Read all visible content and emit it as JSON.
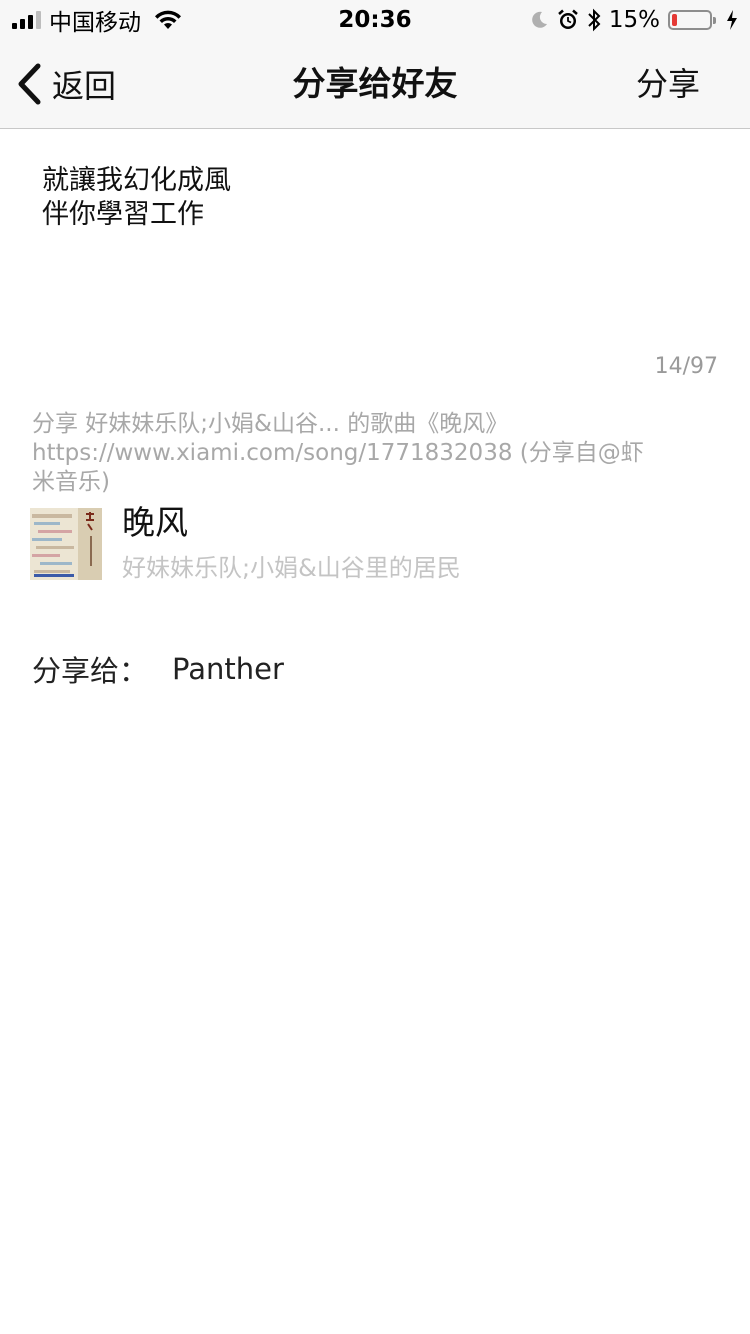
{
  "status_bar": {
    "carrier": "中国移动",
    "time": "20:36",
    "battery_percent": "15%",
    "battery_level": 0.15,
    "battery_color": "#e53935"
  },
  "nav": {
    "back_label": "返回",
    "title": "分享给好友",
    "share_label": "分享"
  },
  "message": {
    "text": "就讓我幻化成風\n伴你學習工作",
    "char_count": "14/97"
  },
  "share_description": "分享  好妹妹乐队;小娟&山谷... 的歌曲《晚风》https://www.xiami.com/song/1771832038 (分享自@虾米音乐)",
  "song": {
    "title": "晚风",
    "artist": "好妹妹乐队;小娟&山谷里的居民",
    "cover_icon": "album-cover"
  },
  "recipient": {
    "label": "分享给：",
    "name": "Panther"
  },
  "icons": {
    "signal": "signal-icon",
    "wifi": "wifi-icon",
    "moon": "moon-icon",
    "alarm": "alarm-icon",
    "bluetooth": "bluetooth-icon",
    "battery": "battery-icon",
    "charging": "charging-icon",
    "back": "chevron-left-icon"
  }
}
